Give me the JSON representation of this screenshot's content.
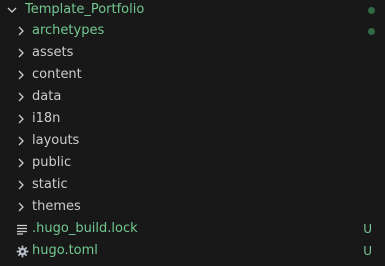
{
  "colors": {
    "background": "#181818",
    "text_default": "#cccccc",
    "text_untracked": "#73c991",
    "dot_untracked": "#73c991",
    "dot_muted": "#2f6a45",
    "chevron": "#cccccc"
  },
  "explorer": {
    "root": {
      "label": "Template_Portfolio",
      "icon": "chevron-down-icon",
      "status": "dot"
    },
    "folders": [
      {
        "label": "archetypes",
        "icon": "chevron-right-icon",
        "status": "dot"
      },
      {
        "label": "assets",
        "icon": "chevron-right-icon"
      },
      {
        "label": "content",
        "icon": "chevron-right-icon"
      },
      {
        "label": "data",
        "icon": "chevron-right-icon"
      },
      {
        "label": "i18n",
        "icon": "chevron-right-icon"
      },
      {
        "label": "layouts",
        "icon": "chevron-right-icon"
      },
      {
        "label": "public",
        "icon": "chevron-right-icon"
      },
      {
        "label": "static",
        "icon": "chevron-right-icon"
      },
      {
        "label": "themes",
        "icon": "chevron-right-icon"
      }
    ],
    "files": [
      {
        "label": ".hugo_build.lock",
        "icon": "lines-file-icon",
        "badge": "U"
      },
      {
        "label": "hugo.toml",
        "icon": "gear-icon",
        "badge": "U"
      }
    ]
  }
}
